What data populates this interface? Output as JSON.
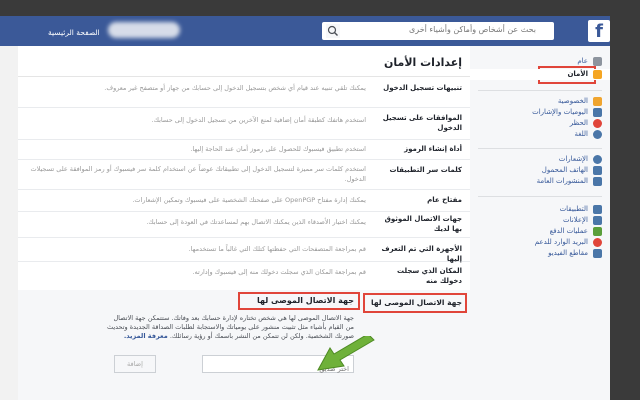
{
  "header": {
    "logo": "f",
    "search_placeholder": "بحث عن أشخاص وأماكن وأشياء أخرى",
    "home_link": "الصفحة الرئيسية"
  },
  "page": {
    "title": "إعدادات الأمان"
  },
  "settings_rows": [
    {
      "label": "تنبيهات تسجيل الدخول",
      "desc": "يمكنك تلقي تنبيه عند قيام أي شخص بتسجيل الدخول إلى حسابك من جهاز أو متصفح غير معروف."
    },
    {
      "label": "الموافقات على تسجيل الدخول",
      "desc": "استخدم هاتفك كطبقة أمان إضافية لمنع الآخرين من تسجيل الدخول إلى حسابك."
    },
    {
      "label": "أداة إنشاء الرموز",
      "desc": "استخدم تطبيق فيسبوك للحصول على رموز أمان عند الحاجة إليها."
    },
    {
      "label": "كلمات سر التطبيقات",
      "desc": "استخدم كلمات سر مميزة لتسجيل الدخول إلى تطبيقاتك عوضاً عن استخدام كلمة سر فيسبوك أو رمز الموافقة على تسجيلات الدخول."
    },
    {
      "label": "مفتاح عام",
      "desc": "يمكنك إدارة مفتاح OpenPGP على صفحتك الشخصية على فيسبوك وتمكين الإشعارات."
    },
    {
      "label": "جهات الاتصال الموثوق بها لديك",
      "desc": "يمكنك اختيار الأصدقاء الذين يمكنك الاتصال بهم لمساعدتك في العودة إلى حسابك."
    },
    {
      "label": "الأجهزة التي تم التعرف إليها",
      "desc": "قم بمراجعة المتصفحات التي حفظتها كتلك التي غالباً ما تستخدمها."
    },
    {
      "label": "المكان الذي سجلت دخولك منه",
      "desc": "قم بمراجعة المكان الذي سجلت دخولك منه إلى فيسبوك وإدارته."
    }
  ],
  "expanded": {
    "label": "جهة الاتصال الموصى لها",
    "heading": "جهة الاتصال الموصى لها",
    "text": "جهة الاتصال الموصى لها هي شخص تختاره لإدارة حسابك بعد وفاتك. ستتمكن جهة الاتصال من القيام بأشياء مثل تثبيت منشور على يومياتك والاستجابة لطلبات الصداقة الجديدة وتحديث صورتك الشخصية. ولكن لن تتمكن من النشر باسمك أو رؤية رسائلك.",
    "learn_more": "معرفة المزيد.",
    "input_placeholder": "اختر صديق",
    "add_button": "إضافة"
  },
  "sidebar": {
    "group1": [
      {
        "label": "عام",
        "icon": "gear-icon",
        "color": "#8d949e"
      },
      {
        "label": "الأمان",
        "icon": "shield-icon",
        "color": "#f5a623",
        "active": true
      }
    ],
    "group2": [
      {
        "label": "الخصوصية",
        "icon": "lock-icon",
        "color": "#f0a52f"
      },
      {
        "label": "اليوميات والإشارات",
        "icon": "timeline-icon",
        "color": "#4a76a8"
      },
      {
        "label": "الحظر",
        "icon": "block-icon",
        "color": "#e0453a"
      },
      {
        "label": "اللغة",
        "icon": "globe-icon",
        "color": "#4a76a8"
      }
    ],
    "group3": [
      {
        "label": "الإشعارات",
        "icon": "globe-icon",
        "color": "#4a76a8"
      },
      {
        "label": "الهاتف المحمول",
        "icon": "phone-icon",
        "color": "#4a76a8"
      },
      {
        "label": "المنشورات العامة",
        "icon": "rss-icon",
        "color": "#4a76a8"
      }
    ],
    "group4": [
      {
        "label": "التطبيقات",
        "icon": "apps-icon",
        "color": "#4a76a8"
      },
      {
        "label": "الإعلانات",
        "icon": "ads-icon",
        "color": "#4a76a8"
      },
      {
        "label": "عمليات الدفع",
        "icon": "payments-icon",
        "color": "#5b9f3b"
      },
      {
        "label": "البريد الوارد للدعم",
        "icon": "support-icon",
        "color": "#e0453a"
      },
      {
        "label": "مقاطع الفيديو",
        "icon": "video-icon",
        "color": "#4a76a8"
      }
    ]
  }
}
